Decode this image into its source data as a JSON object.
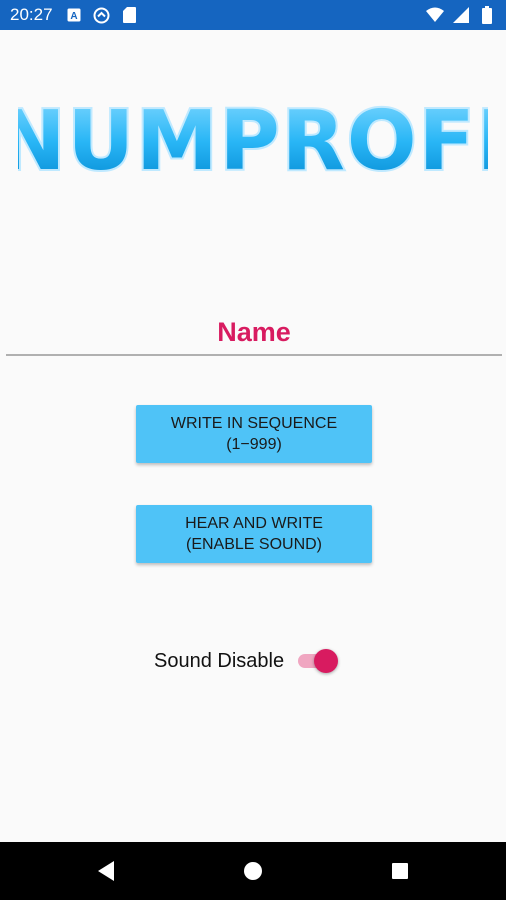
{
  "status_bar": {
    "time": "20:27",
    "left_icons": [
      "text-recognition-icon",
      "sync-icon",
      "sd-card-icon"
    ],
    "right_icons": [
      "wifi-icon",
      "signal-icon",
      "battery-icon"
    ]
  },
  "logo": {
    "text": "NUMPROFI"
  },
  "name_field": {
    "placeholder": "Name",
    "value": ""
  },
  "buttons": {
    "sequence": {
      "line1": "WRITE IN SEQUENCE",
      "line2": "(1−999)"
    },
    "hear": {
      "line1": "HEAR AND WRITE",
      "line2": "(ENABLE SOUND)"
    }
  },
  "sound": {
    "label": "Sound Disable",
    "checked": true
  },
  "colors": {
    "status_bar": "#1565c0",
    "accent": "#d81b60",
    "button": "#4fc3f7",
    "background": "#fafafa"
  },
  "nav_bar": {
    "icons": [
      "back-icon",
      "home-icon",
      "recents-icon"
    ]
  }
}
